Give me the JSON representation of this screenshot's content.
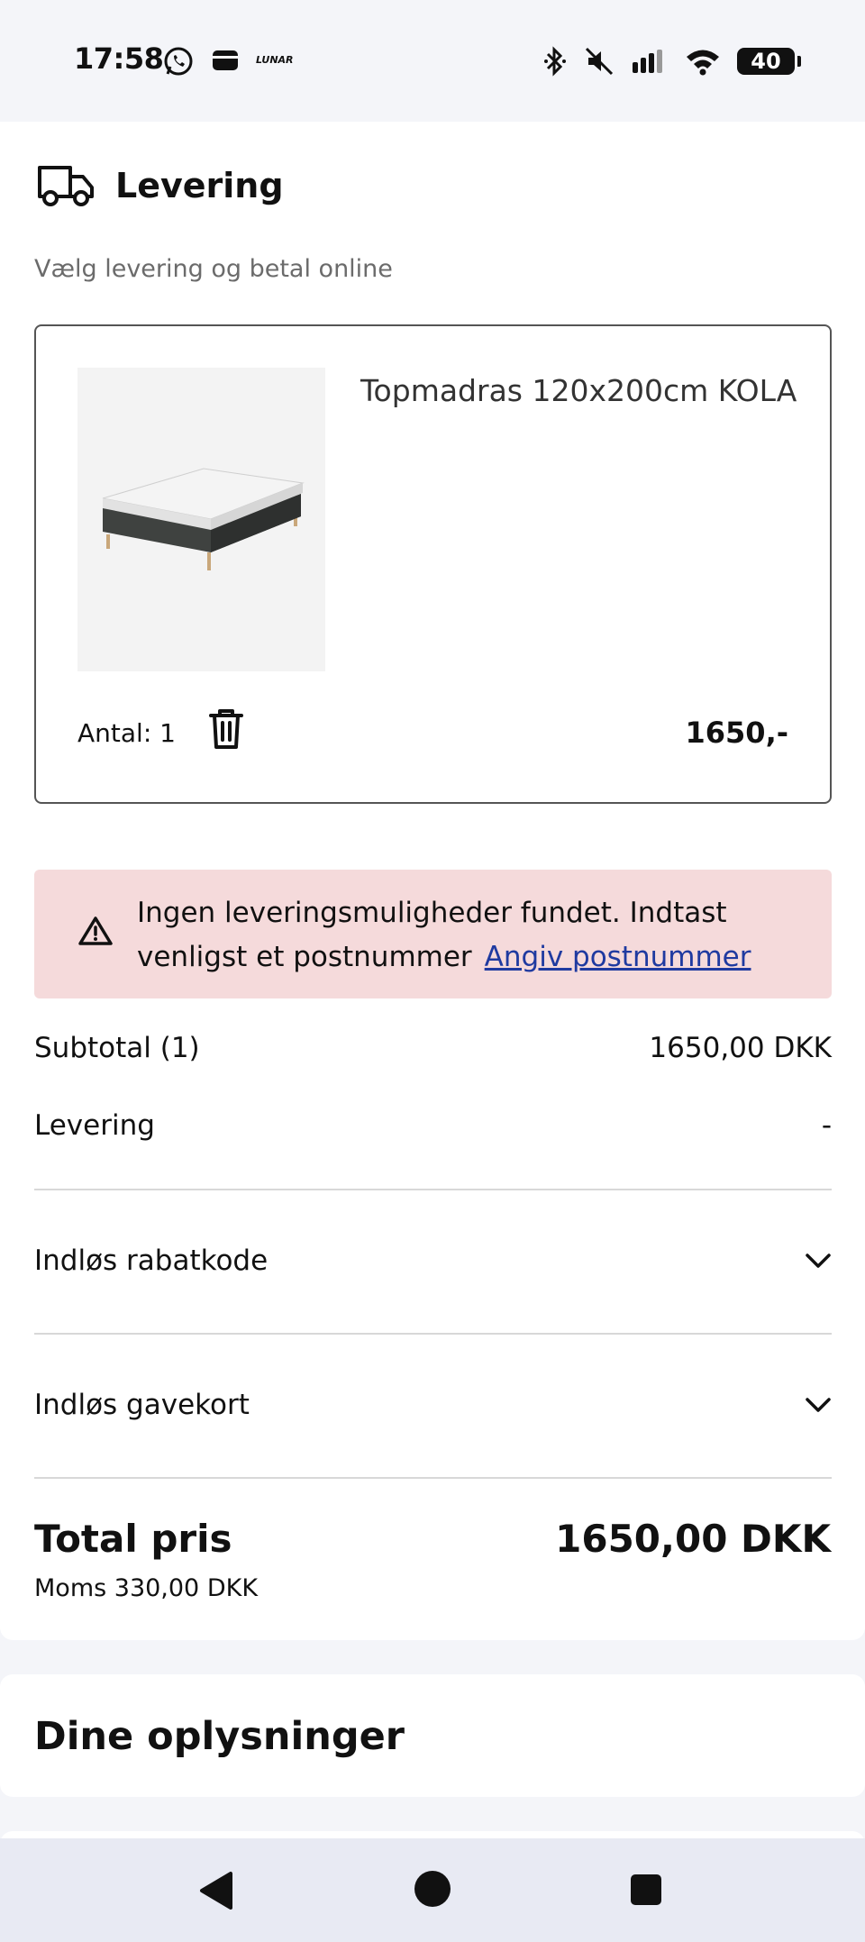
{
  "status_bar": {
    "time": "17:58",
    "left_icons": [
      "whatsapp-icon",
      "wallet-icon",
      "lunar-icon"
    ],
    "lunar_text": "LUNAR",
    "right_icons": [
      "bluetooth-icon",
      "mute-icon",
      "signal-icon",
      "wifi-icon"
    ],
    "battery": "40"
  },
  "delivery": {
    "title": "Levering",
    "subtitle": "Vælg levering og betal online"
  },
  "product": {
    "name": "Topmadras 120x200cm KOLA",
    "quantity_label": "Antal: 1",
    "price": "1650,-"
  },
  "alert": {
    "message": "Ingen leveringsmuligheder fundet. Indtast venligst et postnummer",
    "link": "Angiv postnummer",
    "background": "#f5dadb"
  },
  "summary": {
    "subtotal_label": "Subtotal (1)",
    "subtotal_value": "1650,00 DKK",
    "delivery_label": "Levering",
    "delivery_value": "-"
  },
  "accordions": {
    "discount": "Indløs rabatkode",
    "giftcard": "Indløs gavekort"
  },
  "total": {
    "label": "Total pris",
    "value": "1650,00 DKK",
    "vat": "Moms 330,00 DKK"
  },
  "info_section": {
    "title": "Dine oplysninger"
  }
}
